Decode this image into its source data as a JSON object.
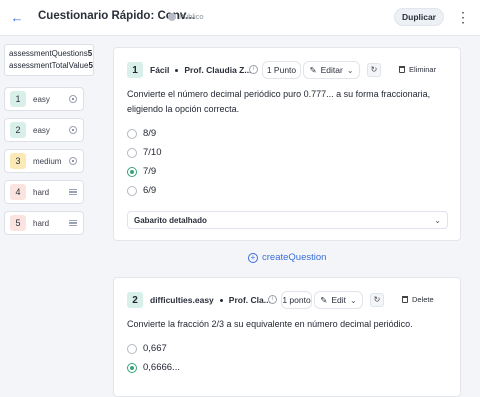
{
  "header": {
    "title": "Cuestionario Rápido: Conv...",
    "visibility": "Público",
    "duplicate_label": "Duplicar"
  },
  "sidebar": {
    "stats": [
      {
        "label": "assessmentQuestions",
        "value": "5"
      },
      {
        "label": "assessmentTotalValue",
        "value": "5"
      }
    ],
    "items": [
      {
        "num": "1",
        "label": "easy",
        "num_bg": "#d9efe9",
        "indicator": "radio"
      },
      {
        "num": "2",
        "label": "easy",
        "num_bg": "#d9efe9",
        "indicator": "radio"
      },
      {
        "num": "3",
        "label": "medium",
        "num_bg": "#fbe9b8",
        "indicator": "radio"
      },
      {
        "num": "4",
        "label": "hard",
        "num_bg": "#fbe3df",
        "indicator": "lines"
      },
      {
        "num": "5",
        "label": "hard",
        "num_bg": "#fbe3df",
        "indicator": "lines"
      }
    ]
  },
  "questions": [
    {
      "num": "1",
      "difficulty": "Fácil",
      "author": "Prof. Claudia Z...",
      "points": "1 Punto",
      "edit_label": "Editar",
      "delete_label": "Eliminar",
      "text": "Convierte el número decimal periódico puro 0.777... a su forma fraccionaria, eligiendo la opción correcta.",
      "options": [
        {
          "label": "8/9",
          "selected": false
        },
        {
          "label": "7/10",
          "selected": false
        },
        {
          "label": "7/9",
          "selected": true
        },
        {
          "label": "6/9",
          "selected": false
        }
      ],
      "explanation_label": "Gabarito detalhado"
    },
    {
      "num": "2",
      "difficulty": "difficulties.easy",
      "author": "Prof. Cla...",
      "points": "1 ponto",
      "edit_label": "Edit",
      "delete_label": "Delete",
      "text": "Convierte la fracción 2/3 a su equivalente en número decimal periódico.",
      "options": [
        {
          "label": "0,667",
          "selected": false
        },
        {
          "label": "0,6666...",
          "selected": true
        }
      ]
    }
  ],
  "create_label": "createQuestion",
  "colors": {
    "accent": "#3b6fd8",
    "correct": "#3aa37a"
  }
}
